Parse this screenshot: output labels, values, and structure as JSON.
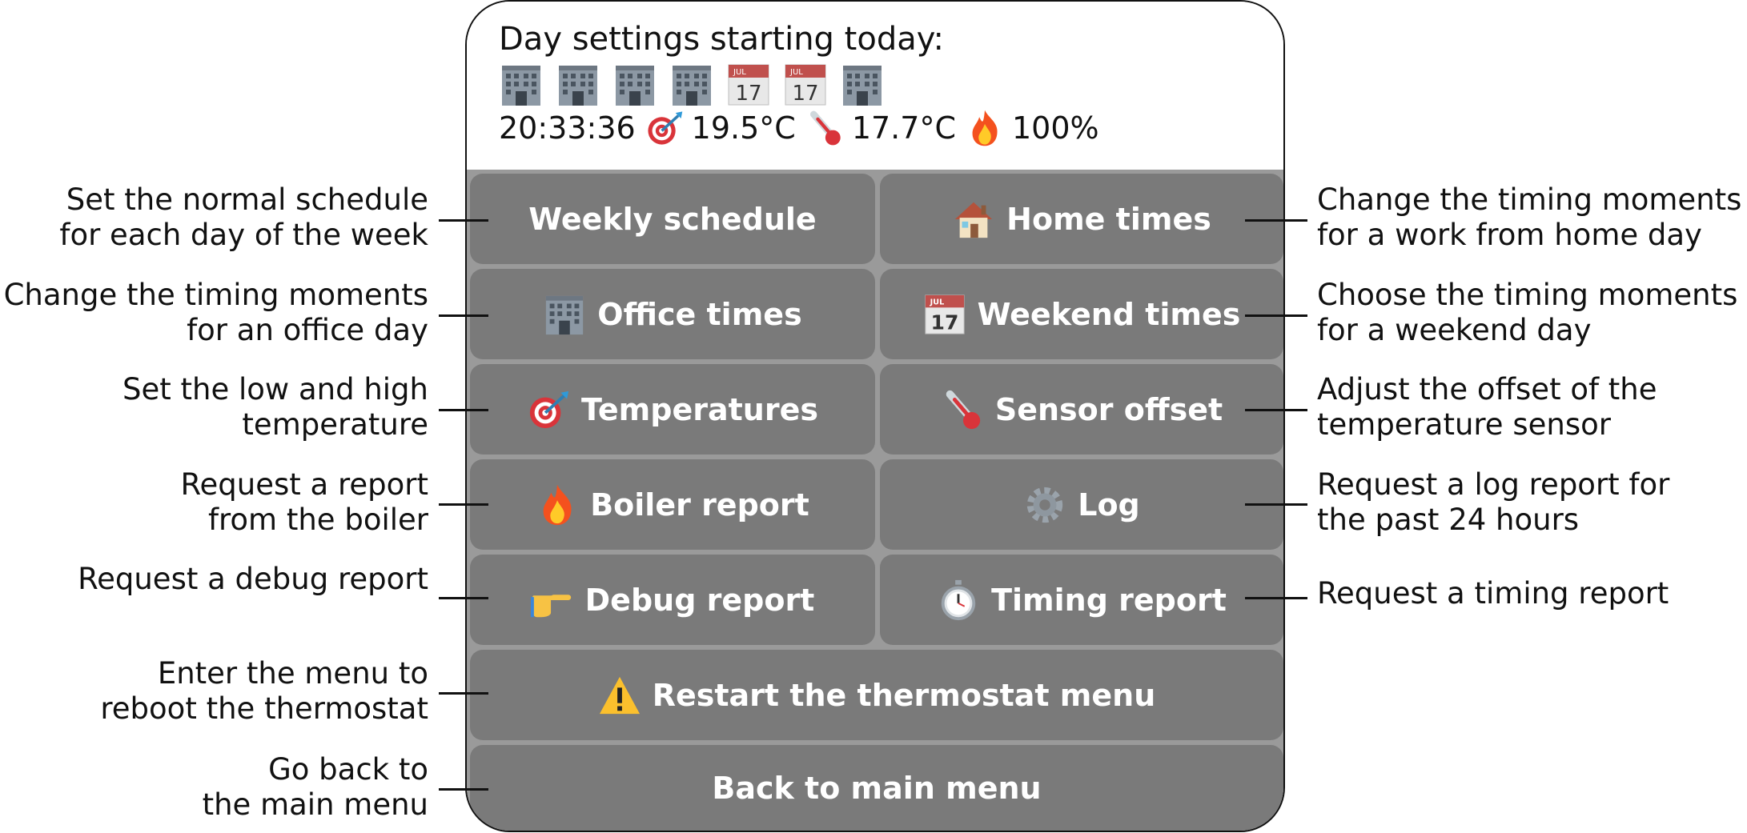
{
  "header": {
    "title": "Day settings starting today:",
    "day_icons": [
      "office-icon",
      "office-icon",
      "office-icon",
      "office-icon",
      "calendar-icon",
      "calendar-icon",
      "office-icon"
    ],
    "calendar_month": "JUL",
    "calendar_day": "17",
    "status": {
      "time": "20:33:36",
      "target_temp": "19.5°C",
      "current_temp": "17.7°C",
      "boiler_level": "100%"
    }
  },
  "buttons": {
    "weekly_schedule": "Weekly schedule",
    "home_times": "Home times",
    "office_times": "Office times",
    "weekend_times": "Weekend times",
    "temperatures": "Temperatures",
    "sensor_offset": "Sensor offset",
    "boiler_report": "Boiler report",
    "log": "Log",
    "debug_report": "Debug report",
    "timing_report": "Timing report",
    "restart_menu": "Restart the thermostat menu",
    "back_main": "Back to main menu"
  },
  "annotations": {
    "weekly_schedule": [
      "Set the normal schedule",
      "for each day of the week"
    ],
    "office_times": [
      "Change the timing moments",
      "for an office day"
    ],
    "temperatures": [
      "Set the low and high",
      "temperature"
    ],
    "boiler_report": [
      "Request a report",
      "from the boiler"
    ],
    "debug_report": [
      "Request a debug report"
    ],
    "restart_menu": [
      "Enter the menu to",
      "reboot the thermostat"
    ],
    "back_main": [
      "Go back to",
      "the main menu"
    ],
    "home_times": [
      "Change the timing moments",
      "for a work from home day"
    ],
    "weekend_times": [
      "Choose the timing moments",
      "for a weekend day"
    ],
    "sensor_offset": [
      "Adjust the offset of the",
      "temperature sensor"
    ],
    "log": [
      "Request a log report for",
      "the past 24 hours"
    ],
    "timing_report": [
      "Request a timing report"
    ]
  },
  "colors": {
    "button_bg": "#7a7a7a",
    "button_text": "#ffffff",
    "panel_bg": "#9a9a9a",
    "outline": "#111111"
  }
}
